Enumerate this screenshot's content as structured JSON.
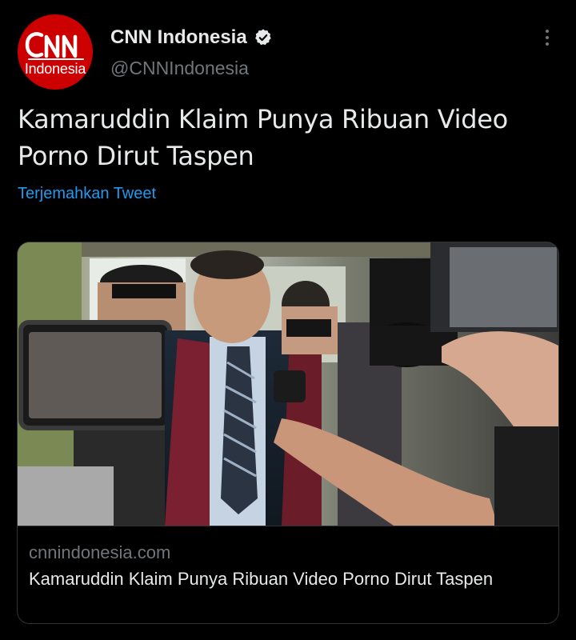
{
  "author": {
    "avatar_logo": "CNN",
    "avatar_subtitle": "Indonesia",
    "display_name": "CNN Indonesia",
    "handle": "@CNNIndonesia",
    "verified": true
  },
  "tweet": {
    "text": "Kamaruddin Klaim Punya Ribuan Video Porno Dirut Taspen",
    "translate_label": "Terjemahkan Tweet"
  },
  "card": {
    "image_icon": "press-photo-crowd-microphones",
    "domain": "cnnindonesia.com",
    "title": "Kamaruddin Klaim Punya Ribuan Video Porno Dirut Taspen"
  },
  "colors": {
    "background": "#000000",
    "text": "#e7e9ea",
    "muted": "#71767b",
    "link": "#1d9bf0",
    "cnn_red": "#cc0000",
    "border": "#2f3336"
  },
  "icons": {
    "verified": "verified-badge-icon",
    "more": "more-options-icon"
  }
}
